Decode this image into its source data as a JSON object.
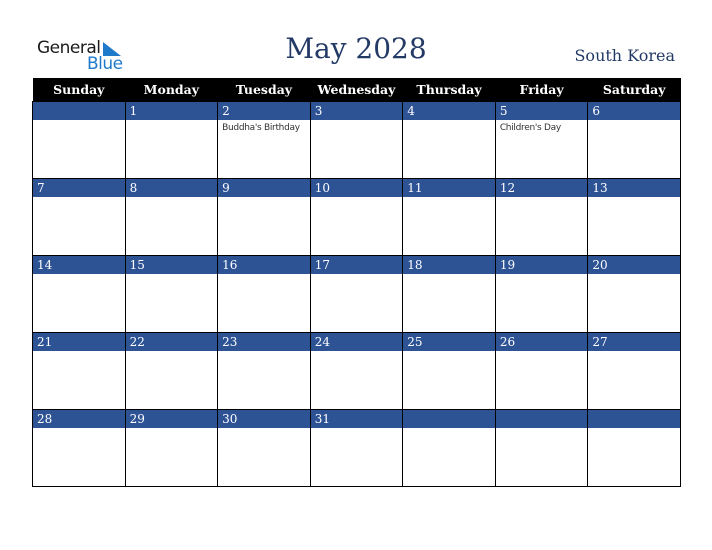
{
  "logo": {
    "line1": "General",
    "line2": "Blue"
  },
  "title": "May 2028",
  "country": "South Korea",
  "weekdays": [
    "Sunday",
    "Monday",
    "Tuesday",
    "Wednesday",
    "Thursday",
    "Friday",
    "Saturday"
  ],
  "weeks": [
    [
      {
        "day": "",
        "event": ""
      },
      {
        "day": "1",
        "event": ""
      },
      {
        "day": "2",
        "event": "Buddha's Birthday"
      },
      {
        "day": "3",
        "event": ""
      },
      {
        "day": "4",
        "event": ""
      },
      {
        "day": "5",
        "event": "Children's Day"
      },
      {
        "day": "6",
        "event": ""
      }
    ],
    [
      {
        "day": "7",
        "event": ""
      },
      {
        "day": "8",
        "event": ""
      },
      {
        "day": "9",
        "event": ""
      },
      {
        "day": "10",
        "event": ""
      },
      {
        "day": "11",
        "event": ""
      },
      {
        "day": "12",
        "event": ""
      },
      {
        "day": "13",
        "event": ""
      }
    ],
    [
      {
        "day": "14",
        "event": ""
      },
      {
        "day": "15",
        "event": ""
      },
      {
        "day": "16",
        "event": ""
      },
      {
        "day": "17",
        "event": ""
      },
      {
        "day": "18",
        "event": ""
      },
      {
        "day": "19",
        "event": ""
      },
      {
        "day": "20",
        "event": ""
      }
    ],
    [
      {
        "day": "21",
        "event": ""
      },
      {
        "day": "22",
        "event": ""
      },
      {
        "day": "23",
        "event": ""
      },
      {
        "day": "24",
        "event": ""
      },
      {
        "day": "25",
        "event": ""
      },
      {
        "day": "26",
        "event": ""
      },
      {
        "day": "27",
        "event": ""
      }
    ],
    [
      {
        "day": "28",
        "event": ""
      },
      {
        "day": "29",
        "event": ""
      },
      {
        "day": "30",
        "event": ""
      },
      {
        "day": "31",
        "event": ""
      },
      {
        "day": "",
        "event": ""
      },
      {
        "day": "",
        "event": ""
      },
      {
        "day": "",
        "event": ""
      }
    ]
  ]
}
